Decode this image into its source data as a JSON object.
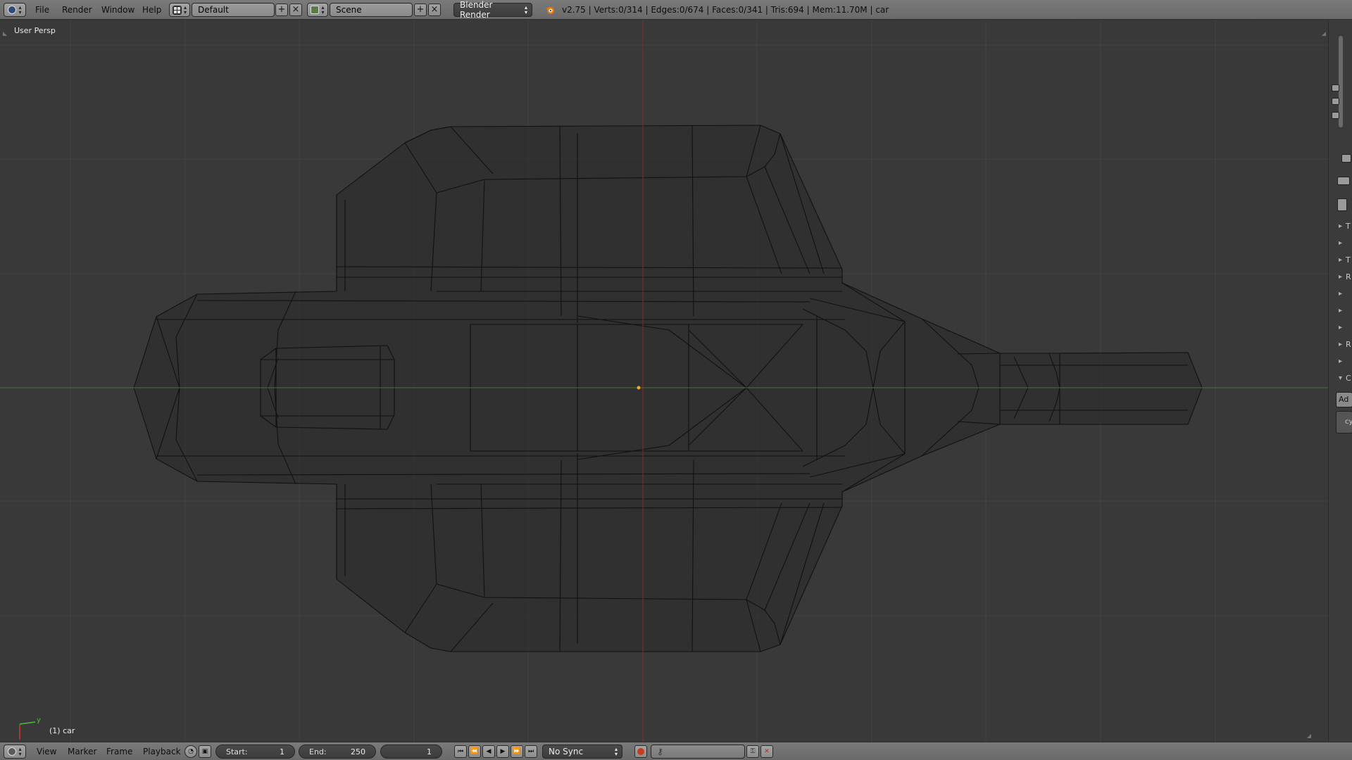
{
  "header": {
    "editor_icon": "info-icon",
    "menus": [
      "File",
      "Render",
      "Window",
      "Help"
    ],
    "screen_layout": "Default",
    "scene": "Scene",
    "render_engine": "Blender Render",
    "stats": "v2.75 | Verts:0/314 | Edges:0/674 | Faces:0/341 | Tris:694 | Mem:11.70M | car"
  },
  "viewport": {
    "view_name": "User Persp",
    "object_label": "(1) car",
    "axis_label_y": "y",
    "colors": {
      "background": "#393939",
      "grid": "#444444",
      "x_axis": "#8a2a2a",
      "y_axis": "#3b7a2a",
      "wire": "#111111",
      "origin": "#f2a52a"
    }
  },
  "right_panel": {
    "letters": [
      "T",
      "",
      "T",
      "R",
      "",
      "",
      "",
      "R",
      "",
      "C",
      "Ad",
      "cy"
    ]
  },
  "footer": {
    "editor_icon": "timeline-icon",
    "menus": [
      "View",
      "Marker",
      "Frame",
      "Playback"
    ],
    "start_label": "Start:",
    "start_value": "1",
    "end_label": "End:",
    "end_value": "250",
    "current_frame": "1",
    "sync": "No Sync"
  }
}
